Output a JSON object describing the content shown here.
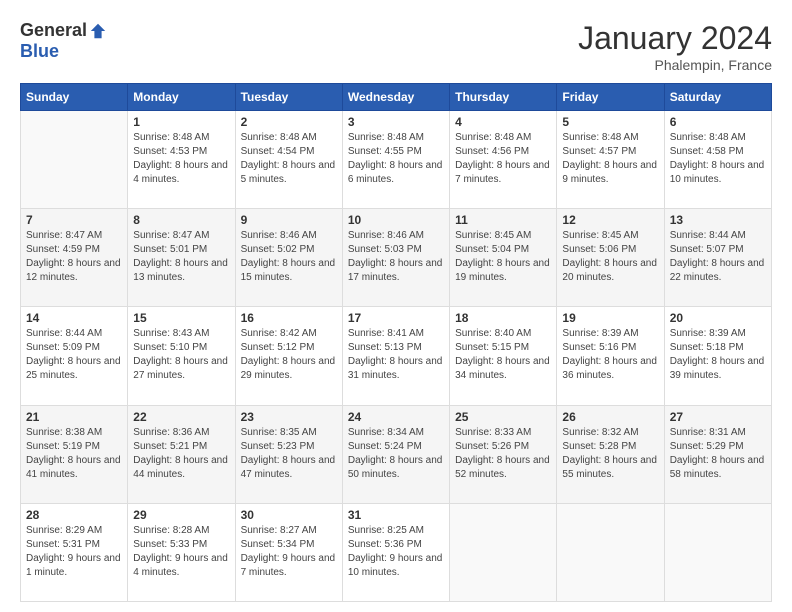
{
  "logo": {
    "general": "General",
    "blue": "Blue"
  },
  "header": {
    "title": "January 2024",
    "location": "Phalempin, France"
  },
  "weekdays": [
    "Sunday",
    "Monday",
    "Tuesday",
    "Wednesday",
    "Thursday",
    "Friday",
    "Saturday"
  ],
  "weeks": [
    {
      "shade": "white",
      "days": [
        {
          "num": "",
          "sunrise": "",
          "sunset": "",
          "daylight": ""
        },
        {
          "num": "1",
          "sunrise": "Sunrise: 8:48 AM",
          "sunset": "Sunset: 4:53 PM",
          "daylight": "Daylight: 8 hours and 4 minutes."
        },
        {
          "num": "2",
          "sunrise": "Sunrise: 8:48 AM",
          "sunset": "Sunset: 4:54 PM",
          "daylight": "Daylight: 8 hours and 5 minutes."
        },
        {
          "num": "3",
          "sunrise": "Sunrise: 8:48 AM",
          "sunset": "Sunset: 4:55 PM",
          "daylight": "Daylight: 8 hours and 6 minutes."
        },
        {
          "num": "4",
          "sunrise": "Sunrise: 8:48 AM",
          "sunset": "Sunset: 4:56 PM",
          "daylight": "Daylight: 8 hours and 7 minutes."
        },
        {
          "num": "5",
          "sunrise": "Sunrise: 8:48 AM",
          "sunset": "Sunset: 4:57 PM",
          "daylight": "Daylight: 8 hours and 9 minutes."
        },
        {
          "num": "6",
          "sunrise": "Sunrise: 8:48 AM",
          "sunset": "Sunset: 4:58 PM",
          "daylight": "Daylight: 8 hours and 10 minutes."
        }
      ]
    },
    {
      "shade": "shade",
      "days": [
        {
          "num": "7",
          "sunrise": "Sunrise: 8:47 AM",
          "sunset": "Sunset: 4:59 PM",
          "daylight": "Daylight: 8 hours and 12 minutes."
        },
        {
          "num": "8",
          "sunrise": "Sunrise: 8:47 AM",
          "sunset": "Sunset: 5:01 PM",
          "daylight": "Daylight: 8 hours and 13 minutes."
        },
        {
          "num": "9",
          "sunrise": "Sunrise: 8:46 AM",
          "sunset": "Sunset: 5:02 PM",
          "daylight": "Daylight: 8 hours and 15 minutes."
        },
        {
          "num": "10",
          "sunrise": "Sunrise: 8:46 AM",
          "sunset": "Sunset: 5:03 PM",
          "daylight": "Daylight: 8 hours and 17 minutes."
        },
        {
          "num": "11",
          "sunrise": "Sunrise: 8:45 AM",
          "sunset": "Sunset: 5:04 PM",
          "daylight": "Daylight: 8 hours and 19 minutes."
        },
        {
          "num": "12",
          "sunrise": "Sunrise: 8:45 AM",
          "sunset": "Sunset: 5:06 PM",
          "daylight": "Daylight: 8 hours and 20 minutes."
        },
        {
          "num": "13",
          "sunrise": "Sunrise: 8:44 AM",
          "sunset": "Sunset: 5:07 PM",
          "daylight": "Daylight: 8 hours and 22 minutes."
        }
      ]
    },
    {
      "shade": "white",
      "days": [
        {
          "num": "14",
          "sunrise": "Sunrise: 8:44 AM",
          "sunset": "Sunset: 5:09 PM",
          "daylight": "Daylight: 8 hours and 25 minutes."
        },
        {
          "num": "15",
          "sunrise": "Sunrise: 8:43 AM",
          "sunset": "Sunset: 5:10 PM",
          "daylight": "Daylight: 8 hours and 27 minutes."
        },
        {
          "num": "16",
          "sunrise": "Sunrise: 8:42 AM",
          "sunset": "Sunset: 5:12 PM",
          "daylight": "Daylight: 8 hours and 29 minutes."
        },
        {
          "num": "17",
          "sunrise": "Sunrise: 8:41 AM",
          "sunset": "Sunset: 5:13 PM",
          "daylight": "Daylight: 8 hours and 31 minutes."
        },
        {
          "num": "18",
          "sunrise": "Sunrise: 8:40 AM",
          "sunset": "Sunset: 5:15 PM",
          "daylight": "Daylight: 8 hours and 34 minutes."
        },
        {
          "num": "19",
          "sunrise": "Sunrise: 8:39 AM",
          "sunset": "Sunset: 5:16 PM",
          "daylight": "Daylight: 8 hours and 36 minutes."
        },
        {
          "num": "20",
          "sunrise": "Sunrise: 8:39 AM",
          "sunset": "Sunset: 5:18 PM",
          "daylight": "Daylight: 8 hours and 39 minutes."
        }
      ]
    },
    {
      "shade": "shade",
      "days": [
        {
          "num": "21",
          "sunrise": "Sunrise: 8:38 AM",
          "sunset": "Sunset: 5:19 PM",
          "daylight": "Daylight: 8 hours and 41 minutes."
        },
        {
          "num": "22",
          "sunrise": "Sunrise: 8:36 AM",
          "sunset": "Sunset: 5:21 PM",
          "daylight": "Daylight: 8 hours and 44 minutes."
        },
        {
          "num": "23",
          "sunrise": "Sunrise: 8:35 AM",
          "sunset": "Sunset: 5:23 PM",
          "daylight": "Daylight: 8 hours and 47 minutes."
        },
        {
          "num": "24",
          "sunrise": "Sunrise: 8:34 AM",
          "sunset": "Sunset: 5:24 PM",
          "daylight": "Daylight: 8 hours and 50 minutes."
        },
        {
          "num": "25",
          "sunrise": "Sunrise: 8:33 AM",
          "sunset": "Sunset: 5:26 PM",
          "daylight": "Daylight: 8 hours and 52 minutes."
        },
        {
          "num": "26",
          "sunrise": "Sunrise: 8:32 AM",
          "sunset": "Sunset: 5:28 PM",
          "daylight": "Daylight: 8 hours and 55 minutes."
        },
        {
          "num": "27",
          "sunrise": "Sunrise: 8:31 AM",
          "sunset": "Sunset: 5:29 PM",
          "daylight": "Daylight: 8 hours and 58 minutes."
        }
      ]
    },
    {
      "shade": "white",
      "days": [
        {
          "num": "28",
          "sunrise": "Sunrise: 8:29 AM",
          "sunset": "Sunset: 5:31 PM",
          "daylight": "Daylight: 9 hours and 1 minute."
        },
        {
          "num": "29",
          "sunrise": "Sunrise: 8:28 AM",
          "sunset": "Sunset: 5:33 PM",
          "daylight": "Daylight: 9 hours and 4 minutes."
        },
        {
          "num": "30",
          "sunrise": "Sunrise: 8:27 AM",
          "sunset": "Sunset: 5:34 PM",
          "daylight": "Daylight: 9 hours and 7 minutes."
        },
        {
          "num": "31",
          "sunrise": "Sunrise: 8:25 AM",
          "sunset": "Sunset: 5:36 PM",
          "daylight": "Daylight: 9 hours and 10 minutes."
        },
        {
          "num": "",
          "sunrise": "",
          "sunset": "",
          "daylight": ""
        },
        {
          "num": "",
          "sunrise": "",
          "sunset": "",
          "daylight": ""
        },
        {
          "num": "",
          "sunrise": "",
          "sunset": "",
          "daylight": ""
        }
      ]
    }
  ]
}
